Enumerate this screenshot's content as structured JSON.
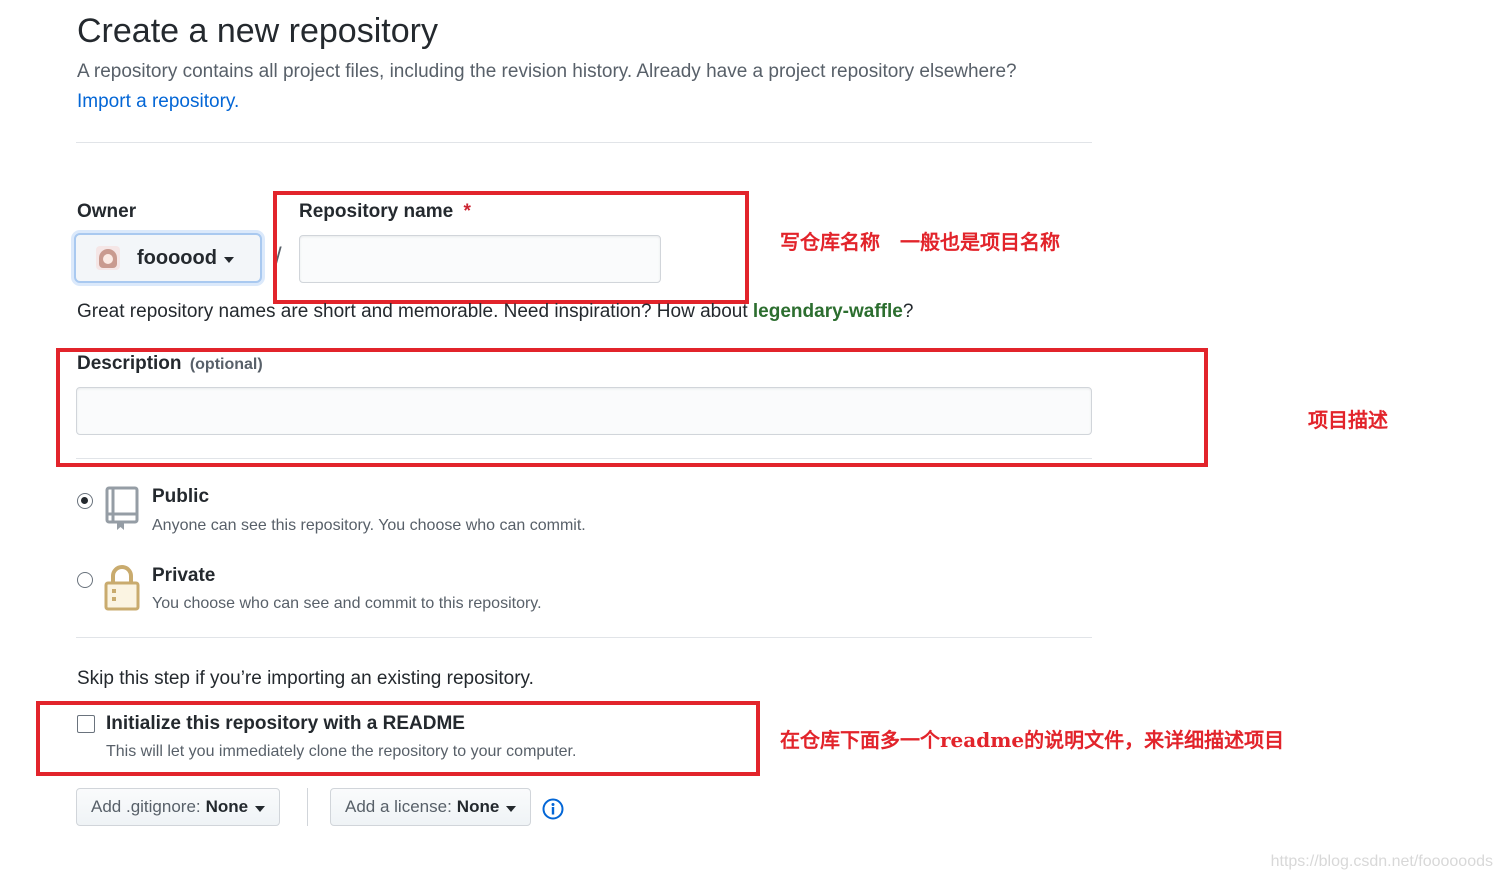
{
  "header": {
    "title": "Create a new repository",
    "subtitle": "A repository contains all project files, including the revision history. Already have a project repository elsewhere?",
    "import_link": "Import a repository."
  },
  "owner": {
    "label": "Owner",
    "selected": "foooood",
    "avatar_icon": "avatar"
  },
  "slash": "/",
  "repo_name": {
    "label": "Repository name",
    "required_mark": "*",
    "value": "",
    "placeholder": ""
  },
  "name_hint": {
    "prefix": "Great repository names are short and memorable. Need inspiration? How about ",
    "suggestion": "legendary-waffle",
    "suffix": "?"
  },
  "description": {
    "label": "Description",
    "optional": "(optional)",
    "value": "",
    "placeholder": ""
  },
  "visibility": {
    "options": [
      {
        "title": "Public",
        "desc": "Anyone can see this repository. You choose who can commit.",
        "checked": true,
        "icon": "repo-book-icon"
      },
      {
        "title": "Private",
        "desc": "You choose who can see and commit to this repository.",
        "checked": false,
        "icon": "lock-icon"
      }
    ]
  },
  "init": {
    "skip_text": "Skip this step if you’re importing an existing repository.",
    "readme_label": "Initialize this repository with a README",
    "readme_desc": "This will let you immediately clone the repository to your computer.",
    "readme_checked": false
  },
  "dropdowns": {
    "gitignore_prefix": "Add .gitignore:",
    "gitignore_value": "None",
    "license_prefix": "Add a license:",
    "license_value": "None",
    "info_icon": "info-icon"
  },
  "annotations": {
    "name_note": "写仓库名称　一般也是项目名称",
    "desc_note": "项目描述",
    "readme_note": "在仓库下面多一个readme的说明文件，来详细描述项目",
    "color": "#e2242b"
  },
  "watermark": "https://blog.csdn.net/foooooods"
}
